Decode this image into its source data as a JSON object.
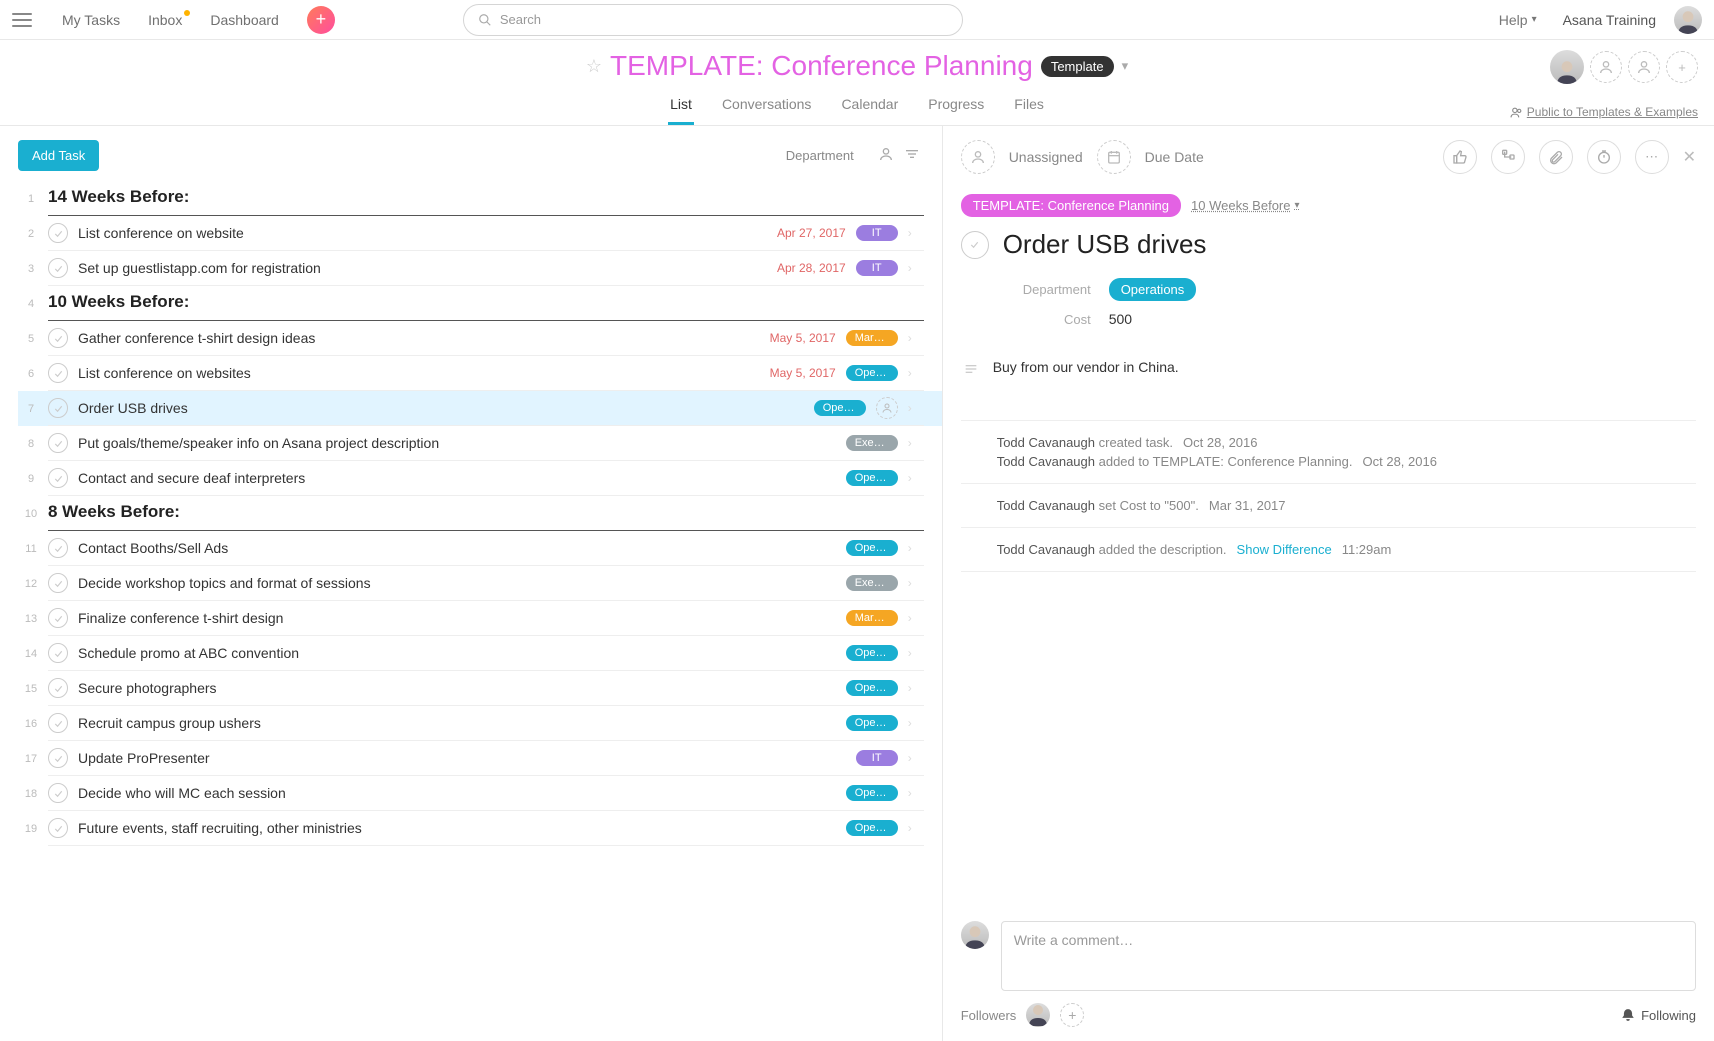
{
  "topbar": {
    "nav": {
      "my_tasks": "My Tasks",
      "inbox": "Inbox",
      "dashboard": "Dashboard"
    },
    "search_placeholder": "Search",
    "help": "Help",
    "workspace": "Asana Training"
  },
  "project": {
    "title": "TEMPLATE: Conference Planning",
    "badge": "Template",
    "tabs": {
      "list": "List",
      "conversations": "Conversations",
      "calendar": "Calendar",
      "progress": "Progress",
      "files": "Files"
    },
    "privacy": "Public to Templates & Examples"
  },
  "list": {
    "add_task": "Add Task",
    "sort_label": "Department",
    "rows": [
      {
        "n": "1",
        "type": "section",
        "title": "14 Weeks Before:"
      },
      {
        "n": "2",
        "type": "task",
        "title": "List conference on website",
        "date": "Apr 27, 2017",
        "tag": "IT",
        "tag_label": "IT"
      },
      {
        "n": "3",
        "type": "task",
        "title": "Set up guestlistapp.com for registration",
        "date": "Apr 28, 2017",
        "tag": "IT",
        "tag_label": "IT"
      },
      {
        "n": "4",
        "type": "section",
        "title": "10 Weeks Before:"
      },
      {
        "n": "5",
        "type": "task",
        "title": "Gather conference t-shirt design ideas",
        "date": "May 5, 2017",
        "tag": "Marketing",
        "tag_label": "Mark…"
      },
      {
        "n": "6",
        "type": "task",
        "title": "List conference on websites",
        "date": "May 5, 2017",
        "tag": "Operations",
        "tag_label": "Oper…"
      },
      {
        "n": "7",
        "type": "task",
        "title": "Order USB drives",
        "tag": "Operations",
        "tag_label": "Oper…",
        "selected": true,
        "assignee_ph": true
      },
      {
        "n": "8",
        "type": "task",
        "title": "Put goals/theme/speaker info on Asana project description",
        "tag": "Executive",
        "tag_label": "Exec…"
      },
      {
        "n": "9",
        "type": "task",
        "title": "Contact and secure deaf interpreters",
        "tag": "Operations",
        "tag_label": "Oper…"
      },
      {
        "n": "10",
        "type": "section",
        "title": "8 Weeks Before:"
      },
      {
        "n": "11",
        "type": "task",
        "title": "Contact Booths/Sell Ads",
        "tag": "Operations",
        "tag_label": "Oper…"
      },
      {
        "n": "12",
        "type": "task",
        "title": "Decide workshop topics and format of sessions",
        "tag": "Executive",
        "tag_label": "Exec…"
      },
      {
        "n": "13",
        "type": "task",
        "title": "Finalize conference t-shirt design",
        "tag": "Marketing",
        "tag_label": "Mark…"
      },
      {
        "n": "14",
        "type": "task",
        "title": "Schedule promo at ABC convention",
        "tag": "Operations",
        "tag_label": "Oper…"
      },
      {
        "n": "15",
        "type": "task",
        "title": "Secure photographers",
        "tag": "Operations",
        "tag_label": "Oper…"
      },
      {
        "n": "16",
        "type": "task",
        "title": "Recruit campus group ushers",
        "tag": "Operations",
        "tag_label": "Oper…"
      },
      {
        "n": "17",
        "type": "task",
        "title": "Update ProPresenter",
        "tag": "IT",
        "tag_label": "IT"
      },
      {
        "n": "18",
        "type": "task",
        "title": "Decide who will MC each session",
        "tag": "Operations",
        "tag_label": "Oper…"
      },
      {
        "n": "19",
        "type": "task",
        "title": "Future events, staff recruiting, other ministries",
        "tag": "Operations",
        "tag_label": "Oper…"
      }
    ]
  },
  "detail": {
    "unassigned": "Unassigned",
    "due_date": "Due Date",
    "project_pill": "TEMPLATE: Conference Planning",
    "section_link": "10 Weeks Before",
    "title": "Order USB drives",
    "fields": {
      "department_label": "Department",
      "department_value": "Operations",
      "cost_label": "Cost",
      "cost_value": "500"
    },
    "description": "Buy from our vendor in China.",
    "activity": [
      {
        "lines": [
          {
            "who": "Todd Cavanaugh",
            "what": "created task.",
            "when": "Oct 28, 2016"
          },
          {
            "who": "Todd Cavanaugh",
            "what": "added to TEMPLATE: Conference Planning.",
            "when": "Oct 28, 2016"
          }
        ]
      },
      {
        "lines": [
          {
            "who": "Todd Cavanaugh",
            "what": "set Cost to \"500\".",
            "when": "Mar 31, 2017"
          }
        ]
      },
      {
        "lines": [
          {
            "who": "Todd Cavanaugh",
            "what": "added the description.",
            "show_diff": "Show Difference",
            "when": "11:29am"
          }
        ]
      }
    ],
    "comment_placeholder": "Write a comment…",
    "followers_label": "Followers",
    "following_label": "Following"
  }
}
